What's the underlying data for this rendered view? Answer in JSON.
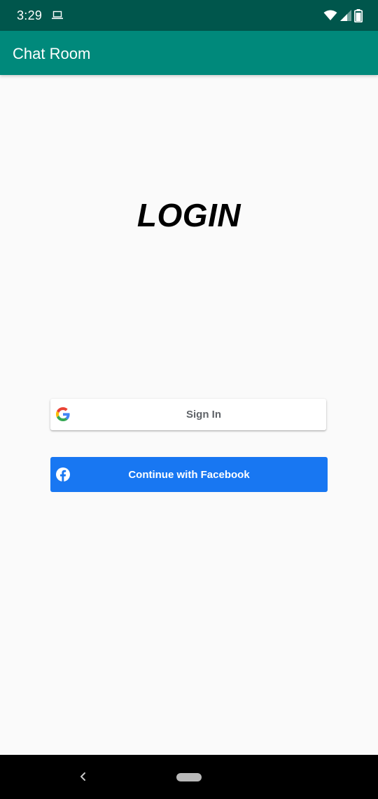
{
  "status_bar": {
    "time": "3:29",
    "icons": [
      "laptop-icon",
      "wifi-icon",
      "signal-icon",
      "battery-icon"
    ],
    "color": "#00564c"
  },
  "app_bar": {
    "title": "Chat Room",
    "color": "#00897b"
  },
  "main": {
    "heading": "LOGIN",
    "google_button": {
      "label": "Sign In",
      "icon": "google-icon"
    },
    "facebook_button": {
      "label": "Continue with Facebook",
      "icon": "facebook-icon",
      "color": "#1877f2"
    }
  },
  "nav_bar": {
    "icons": [
      "back-icon",
      "home-pill-icon"
    ]
  }
}
